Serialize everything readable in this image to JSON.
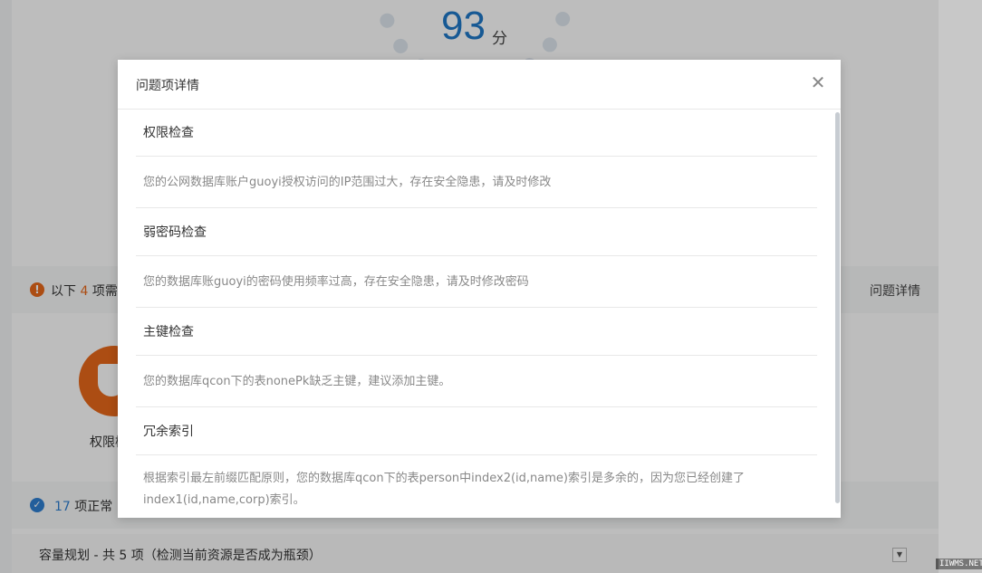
{
  "background": {
    "score_value": "93",
    "score_unit": "分",
    "warning": {
      "prefix": "以下",
      "count": "4",
      "suffix": "项需要",
      "icon": "exclamation-icon",
      "color": "#e8681a"
    },
    "issue_details_link": "问题详情",
    "shield_label": "权限检查",
    "ok": {
      "count": "17",
      "suffix": "项正常",
      "icon": "check-circle-icon",
      "color": "#2f7fd1"
    },
    "capacity_row": "容量规划 - 共 5 项（检测当前资源是否成为瓶颈）",
    "watermark": "IIWMS.NET"
  },
  "modal": {
    "title": "问题项详情",
    "close_icon": "close-icon",
    "sections": [
      {
        "title": "权限检查",
        "desc": "您的公网数据库账户guoyi授权访问的IP范围过大，存在安全隐患，请及时修改"
      },
      {
        "title": "弱密码检查",
        "desc": "您的数据库账guoyi的密码使用频率过高，存在安全隐患，请及时修改密码"
      },
      {
        "title": "主键检查",
        "desc": "您的数据库qcon下的表nonePk缺乏主键，建议添加主键。"
      },
      {
        "title": "冗余索引",
        "desc": "根据索引最左前缀匹配原则，您的数据库qcon下的表person中index2(id,name)索引是多余的，因为您已经创建了index1(id,name,corp)索引。"
      }
    ]
  }
}
